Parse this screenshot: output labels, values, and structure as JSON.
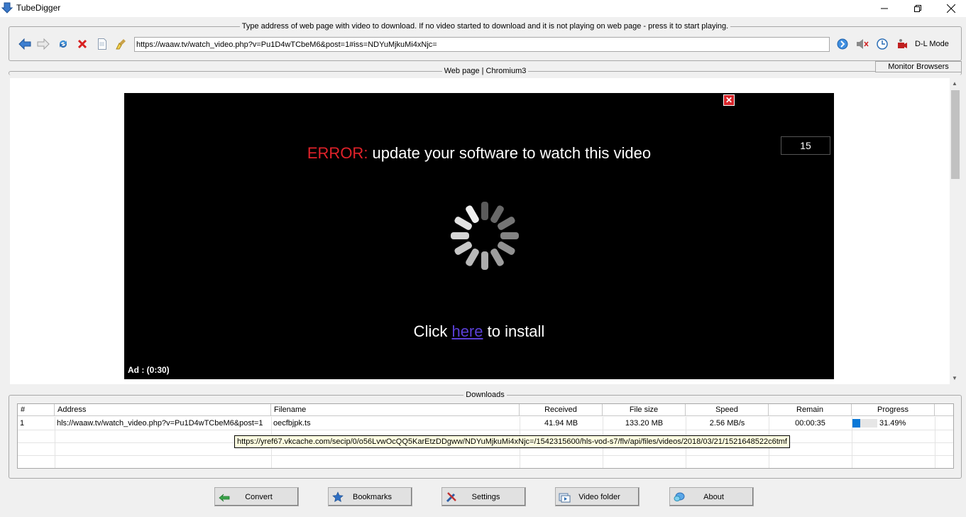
{
  "window": {
    "title": "TubeDigger",
    "minimize_glyph": "—",
    "maximize_glyph": "❐",
    "close_glyph": "✕"
  },
  "address_bar": {
    "legend": "Type address of web page with video to download. If no video started to download and it is not playing on web page - press it to start playing.",
    "url": "https://waaw.tv/watch_video.php?v=Pu1D4wTCbeM6&post=1#iss=NDYuMjkuMi4xNjc=",
    "dl_mode_label": "D-L Mode",
    "toolbar_icons": [
      "back-icon",
      "forward-icon",
      "refresh-icon",
      "stop-icon",
      "page-icon",
      "clear-icon"
    ],
    "right_icons": [
      "go-icon",
      "mute-icon",
      "timer-icon",
      "record-icon"
    ]
  },
  "browser": {
    "legend": "Web page | Chromium3",
    "monitor_button": "Monitor Browsers"
  },
  "video_overlay": {
    "error_prefix": "ERROR:",
    "error_message": " update your software to watch this video",
    "counter": "15",
    "install_prefix": "Click ",
    "install_link": "here",
    "install_suffix": " to install",
    "ad_timer": "Ad : (0:30)",
    "close_glyph": "✕"
  },
  "downloads": {
    "legend": "Downloads",
    "columns": [
      "#",
      "Address",
      "Filename",
      "Received",
      "File size",
      "Speed",
      "Remain",
      "Progress"
    ],
    "rows": [
      {
        "num": "1",
        "address": "hls://waaw.tv/watch_video.php?v=Pu1D4wTCbeM6&post=1",
        "filename": "oecfbjpk.ts",
        "received": "41.94 MB",
        "file_size": "133.20 MB",
        "speed": "2.56 MB/s",
        "remain": "00:00:35",
        "progress_text": "31.49%",
        "progress": 0.3149
      }
    ],
    "tooltip": "https://yref67.vkcache.com/secip/0/o56LvwOcQQ5KarEtzDDgww/NDYuMjkuMi4xNjc=/1542315600/hls-vod-s7/flv/api/files/videos/2018/03/21/1521648522c6tmf"
  },
  "buttons": {
    "convert": "Convert",
    "bookmarks": "Bookmarks",
    "settings": "Settings",
    "video_folder": "Video folder",
    "about": "About"
  },
  "colors": {
    "error_red": "#e0222a",
    "link": "#5a3fd6",
    "progress": "#0a78d7"
  }
}
